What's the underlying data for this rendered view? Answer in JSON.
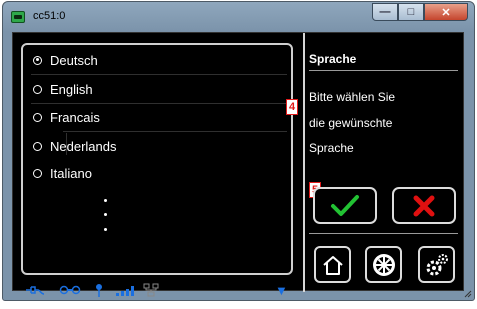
{
  "window": {
    "title": "cc51:0",
    "controls": {
      "minimize": "—",
      "maximize": "□",
      "close": "✕"
    }
  },
  "language_list": {
    "selected_index": 0,
    "items": [
      {
        "label": "Deutsch",
        "selected": true
      },
      {
        "label": "English",
        "selected": false
      },
      {
        "label": "Francais",
        "selected": false
      },
      {
        "label": "Nederlands",
        "selected": false
      },
      {
        "label": "Italiano",
        "selected": false
      }
    ],
    "more_indicator": "⋮"
  },
  "annotations": {
    "list_marker": "4",
    "confirm_marker": "5"
  },
  "info_panel": {
    "heading": "Sprache",
    "lines": [
      "Bitte wählen Sie",
      "die gewünschte",
      "Sprache"
    ]
  },
  "buttons": {
    "confirm_icon": "check-icon",
    "cancel_icon": "x-icon",
    "home_icon": "home-icon",
    "locomotive_icon": "wheel-icon",
    "settings_icon": "gear-icon"
  },
  "status_bar": {
    "icons": [
      "power-plug-icon",
      "track-link-icon",
      "antenna-icon",
      "signal-bars-icon",
      "network-icon"
    ],
    "scroll_arrow": "▼"
  },
  "colors": {
    "accent_blue": "#1a6fe0",
    "confirm_green": "#22c233",
    "cancel_red": "#e01010",
    "marker_red": "#e21b1b"
  }
}
